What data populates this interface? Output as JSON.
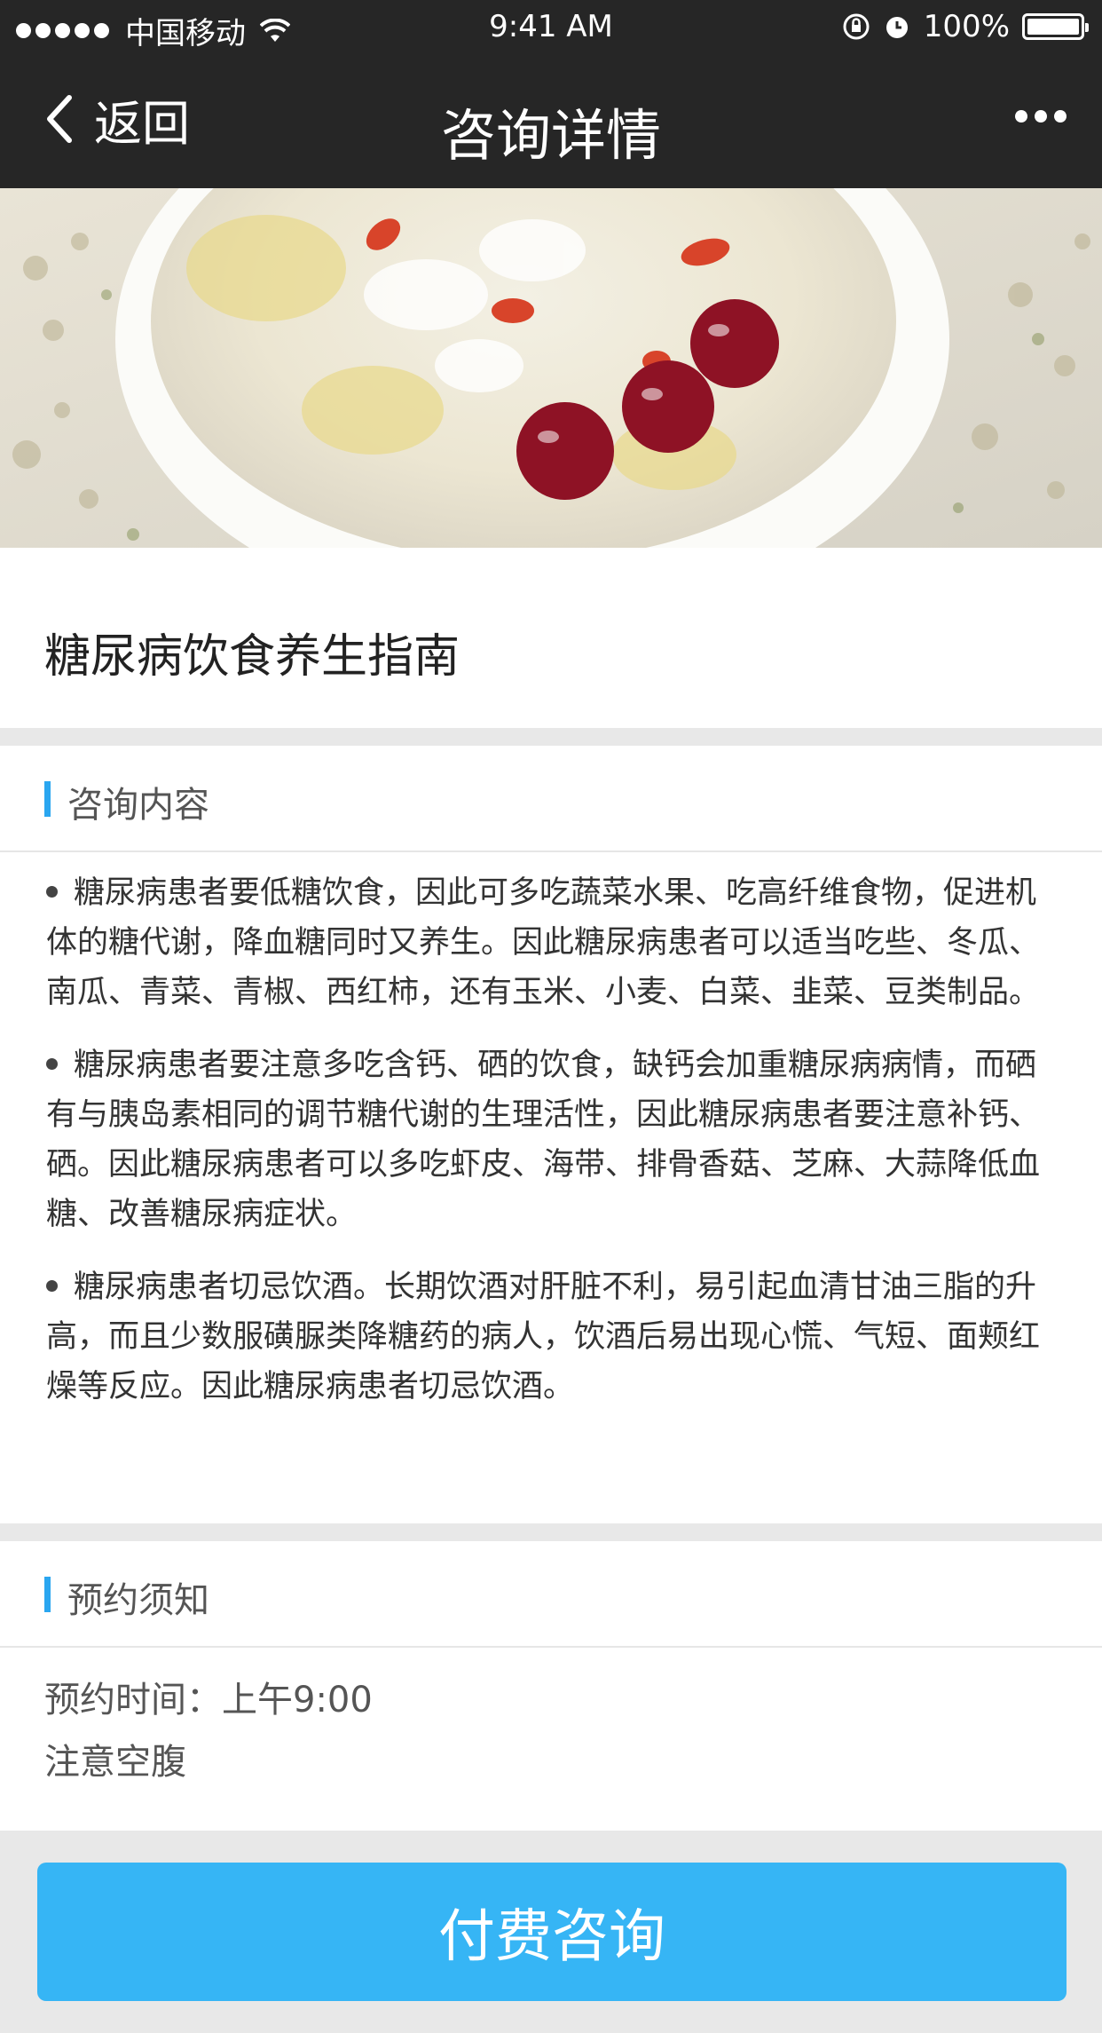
{
  "status_bar": {
    "carrier": "中国移动",
    "time": "9:41 AM",
    "battery": "100%",
    "icons": [
      "signal-dots-icon",
      "wifi-icon",
      "orientation-lock-icon",
      "alarm-icon",
      "battery-icon"
    ]
  },
  "navbar": {
    "back_label": "返回",
    "title": "咨询详情",
    "more_icon": "more-dots-icon"
  },
  "article": {
    "title": "糖尿病饮食养生指南"
  },
  "consult_section": {
    "heading": "咨询内容",
    "paragraphs": [
      "糖尿病患者要低糖饮食，因此可多吃蔬菜水果、吃高纤维食物，促进机体的糖代谢，降血糖同时又养生。因此糖尿病患者可以适当吃些、冬瓜、南瓜、青菜、青椒、西红柿，还有玉米、小麦、白菜、韭菜、豆类制品。",
      "糖尿病患者要注意多吃含钙、硒的饮食，缺钙会加重糖尿病病情，而硒有与胰岛素相同的调节糖代谢的生理活性，因此糖尿病患者要注意补钙、硒。因此糖尿病患者可以多吃虾皮、海带、排骨香菇、芝麻、大蒜降低血糖、改善糖尿病症状。",
      "糖尿病患者切忌饮酒。长期饮酒对肝脏不利，易引起血清甘油三脂的升高，而且少数服磺脲类降糖药的病人，饮酒后易出现心慌、气短、面颊红燥等反应。因此糖尿病患者切忌饮酒。"
    ]
  },
  "notice_section": {
    "heading": "预约须知",
    "lines": [
      "预约时间：上午9:00",
      "注意空腹"
    ]
  },
  "action": {
    "pay_button": "付费咨询"
  },
  "colors": {
    "accent": "#36b5f5",
    "nav_bg": "#262626",
    "section_bar": "#2aa6f0"
  }
}
